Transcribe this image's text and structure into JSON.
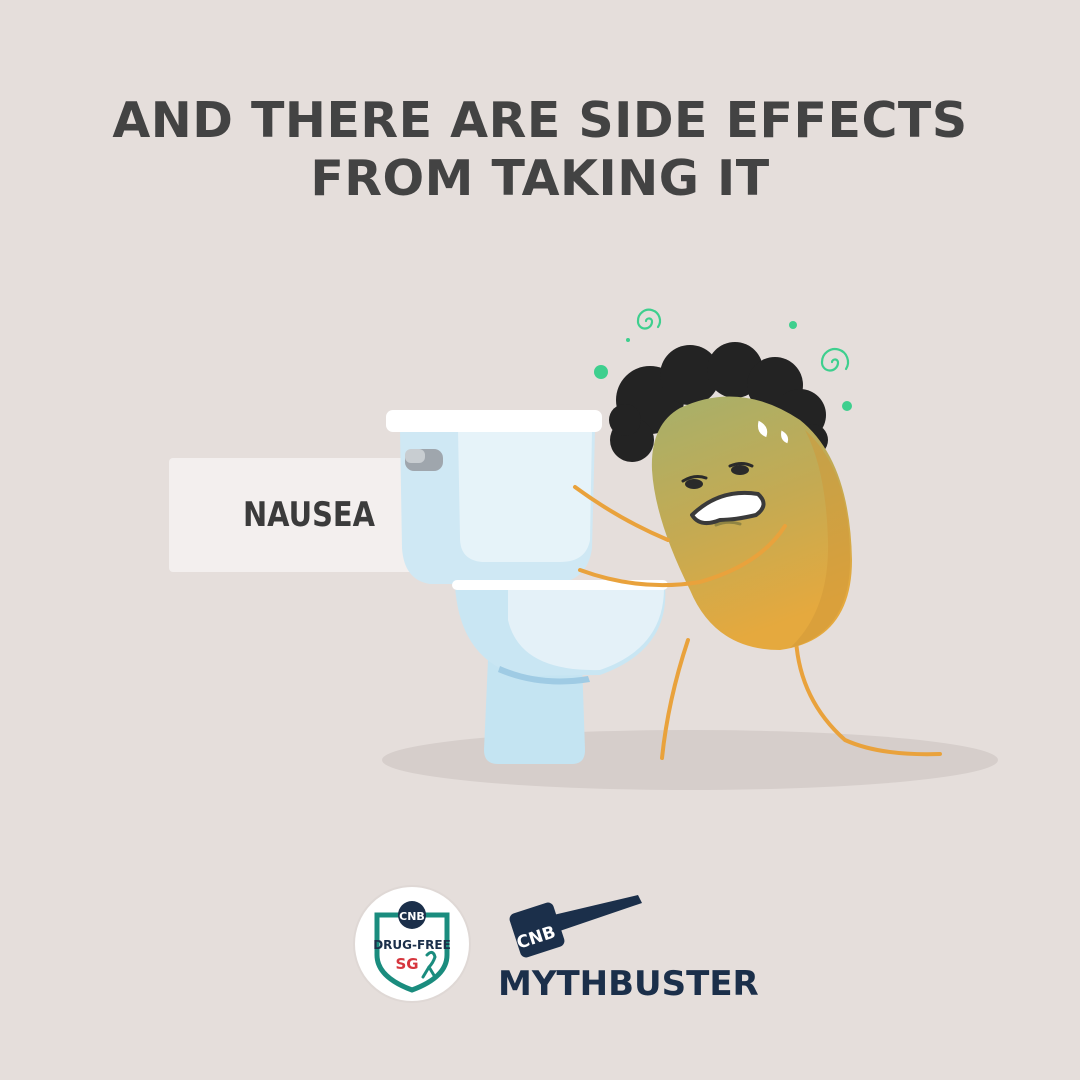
{
  "headline": {
    "line1": "AND THERE ARE SIDE EFFECTS",
    "line2": "FROM TAKING IT"
  },
  "side_effect_label": "NAUSEA",
  "logos": {
    "drugfree_badge": {
      "org": "CNB",
      "line1": "DRUG-FREE",
      "line2": "SG"
    },
    "mythbuster": {
      "org": "CNB",
      "word1": "MYTH",
      "word2": "BUSTER"
    }
  },
  "colors": {
    "background": "#e5dedb",
    "headline": "#434343",
    "character_top": "#a8b06a",
    "character_bottom": "#e0a83f",
    "dizzy_accent": "#3ecf8e",
    "toilet": "#c9e6f3",
    "brand_navy": "#1b2f4a",
    "brand_teal": "#1a8c7e"
  }
}
